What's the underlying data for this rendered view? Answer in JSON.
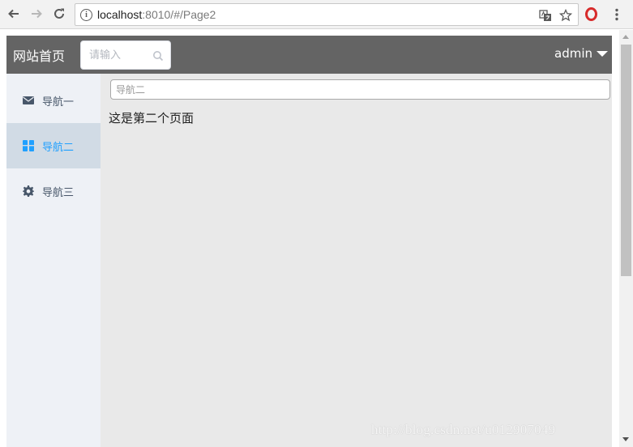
{
  "browser": {
    "url_host": "localhost",
    "url_rest": ":8010/#/Page2"
  },
  "header": {
    "site_title": "网站首页",
    "search_placeholder": "请输入",
    "username": "admin"
  },
  "sidebar": {
    "items": [
      {
        "label": "导航一",
        "icon": "envelope-icon",
        "active": false
      },
      {
        "label": "导航二",
        "icon": "columns-icon",
        "active": true
      },
      {
        "label": "导航三",
        "icon": "gear-icon",
        "active": false
      }
    ]
  },
  "main": {
    "input_placeholder": "导航二",
    "text": "这是第二个页面"
  },
  "watermark": "http://blog.csdn.net/u012907049",
  "colors": {
    "header_bg": "#646464",
    "sidebar_bg": "#eef1f6",
    "active_item_bg": "#d1dbe5",
    "active_item_text": "#20a0ff",
    "main_bg": "#e9e9e9"
  }
}
